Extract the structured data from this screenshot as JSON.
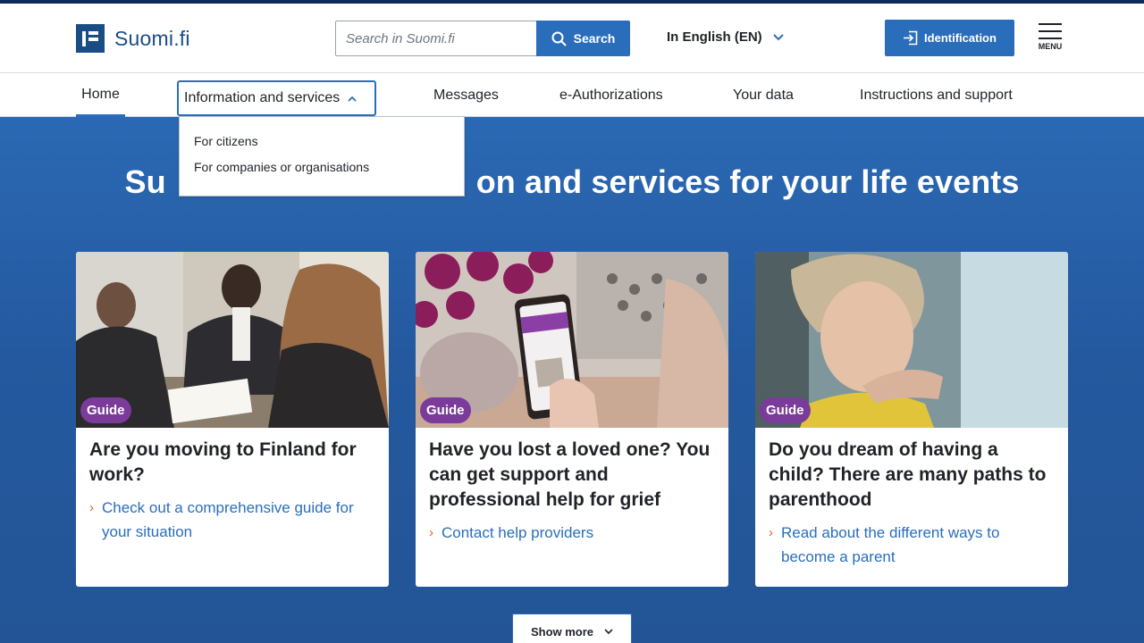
{
  "header": {
    "logo_text": "Suomi.fi",
    "search": {
      "placeholder": "Search in Suomi.fi",
      "button_label": "Search"
    },
    "language": "In English (EN)",
    "identification_label": "Identification",
    "menu_label": "MENU"
  },
  "nav": {
    "items": [
      {
        "label": "Home",
        "active": true
      },
      {
        "label": "Information and services",
        "expanded": true
      },
      {
        "label": "Messages"
      },
      {
        "label": "e-Authorizations"
      },
      {
        "label": "Your data"
      },
      {
        "label": "Instructions and support"
      }
    ],
    "dropdown": [
      "For citizens",
      "For companies or organisations"
    ]
  },
  "hero": {
    "title_left": "Su",
    "title_right": "on and services for your life events"
  },
  "cards": [
    {
      "badge": "Guide",
      "title": "Are you moving to Finland for work?",
      "link": "Check out a comprehensive guide for your situation"
    },
    {
      "badge": "Guide",
      "title": "Have you lost a loved one? You can get support and professional help for grief",
      "link": "Contact help providers"
    },
    {
      "badge": "Guide",
      "title": "Do you dream of having a child? There are many paths to parenthood",
      "link": "Read about the different ways to become a parent"
    }
  ],
  "show_more_label": "Show more",
  "colors": {
    "primary": "#2a6ebb",
    "brand_dark": "#1a4d86",
    "hero_bg": "#24599f",
    "guide_badge": "#7a3b9a",
    "link_arrow": "#e0601e"
  }
}
